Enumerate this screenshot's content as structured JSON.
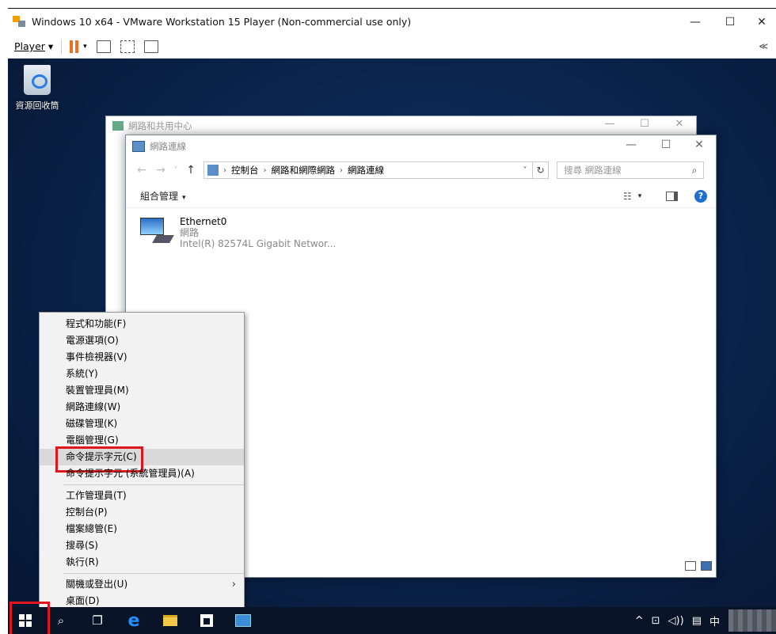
{
  "host": {
    "title": "Windows 10 x64 - VMware Workstation 15 Player (Non-commercial use only)",
    "player_label": "Player",
    "window_controls": [
      "—",
      "☐",
      "✕"
    ],
    "collapse_glyph": "≪"
  },
  "desktop": {
    "recycle_bin_label": "資源回收筒"
  },
  "bg_window": {
    "title": "網路和共用中心",
    "controls": [
      "—",
      "☐",
      "✕"
    ]
  },
  "nc_window": {
    "title": "網路連線",
    "controls": [
      "—",
      "☐",
      "✕"
    ],
    "nav": {
      "back": "←",
      "forward": "→",
      "recent": "˅",
      "up": "↑"
    },
    "address": {
      "crumbs": [
        "控制台",
        "網路和網際網路",
        "網路連線"
      ],
      "separator": "›",
      "dropdown": "˅",
      "refresh": "↻"
    },
    "search_placeholder": "搜尋 網路連線",
    "command": {
      "organize": "組合管理",
      "organize_arrow": "▾",
      "view_arrow": "▾",
      "help": "?"
    },
    "adapter": {
      "name": "Ethernet0",
      "network": "網路",
      "device": "Intel(R) 82574L Gigabit Networ..."
    }
  },
  "context_menu": {
    "groups": [
      [
        "程式和功能(F)",
        "電源選項(O)",
        "事件檢視器(V)",
        "系統(Y)",
        "裝置管理員(M)",
        "網路連線(W)",
        "磁碟管理(K)",
        "電腦管理(G)",
        "命令提示字元(C)",
        "命令提示字元 (系統管理員)(A)"
      ],
      [
        "工作管理員(T)",
        "控制台(P)",
        "檔案總管(E)",
        "搜尋(S)",
        "執行(R)"
      ],
      [
        "關機或登出(U)",
        "桌面(D)"
      ]
    ],
    "highlighted": "命令提示字元(C)",
    "submenu_arrow": "›"
  },
  "taskbar": {
    "search_glyph": "⌕",
    "taskview_glyph": "❐",
    "edge_glyph": "e",
    "tray": {
      "chevron": "^",
      "ime": "中"
    }
  }
}
